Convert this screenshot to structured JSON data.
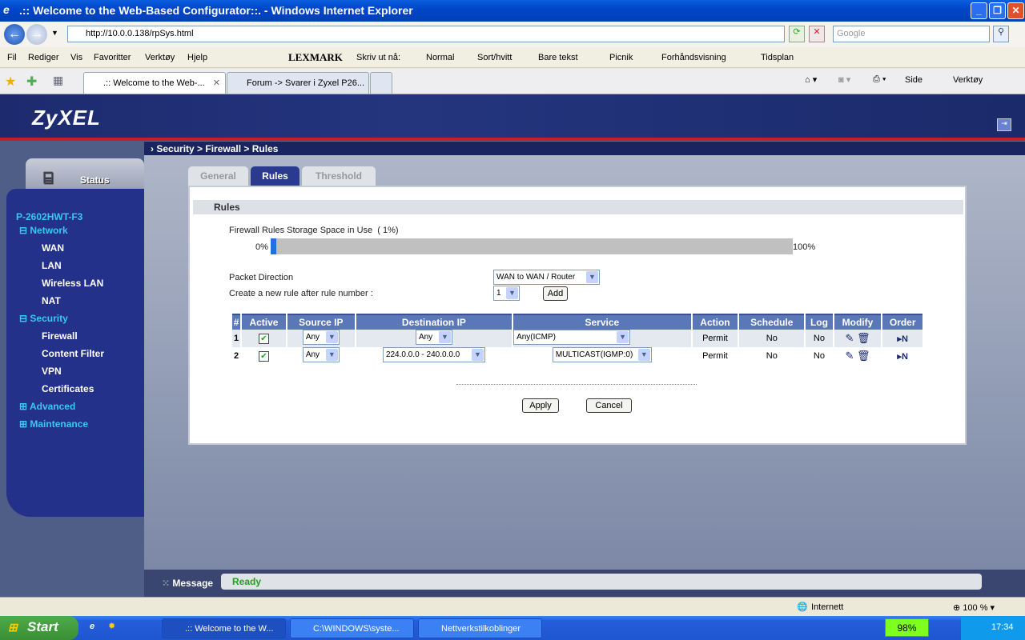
{
  "window": {
    "title": ".:: Welcome to the Web-Based Configurator::. - Windows Internet Explorer"
  },
  "address": {
    "url": "http://10.0.0.138/rpSys.html",
    "search_placeholder": "Google"
  },
  "menu": [
    "Fil",
    "Rediger",
    "Vis",
    "Favoritter",
    "Verktøy",
    "Hjelp"
  ],
  "lexmark": {
    "brand": "LEXMARK",
    "print_label": "Skriv ut nå:",
    "items": [
      "Normal",
      "Sort/hvitt",
      "Bare tekst",
      "Picnik",
      "Forhåndsvisning",
      "Tidsplan"
    ]
  },
  "tabs": [
    ".:: Welcome to the Web-...",
    "Forum -> Svarer i Zyxel P26..."
  ],
  "commandbar": {
    "page": "Side",
    "tools": "Verktøy"
  },
  "router": {
    "logo": "ZyXEL",
    "breadcrumb": "Security > Firewall > Rules",
    "status_tab": "Status",
    "model": "P-2602HWT-F3",
    "sidebar": [
      {
        "label": "Network",
        "sub": [
          "WAN",
          "LAN",
          "Wireless LAN",
          "NAT"
        ]
      },
      {
        "label": "Security",
        "sub": [
          "Firewall",
          "Content Filter",
          "VPN",
          "Certificates"
        ]
      },
      {
        "label": "Advanced",
        "sub": []
      },
      {
        "label": "Maintenance",
        "sub": []
      }
    ],
    "page_tabs": [
      "General",
      "Rules",
      "Threshold"
    ],
    "active_tab": "Rules",
    "section_title": "Rules",
    "storage": {
      "label": "Firewall Rules Storage Space in Use",
      "value_text": "( 1%)",
      "percent": 1,
      "min_label": "0%",
      "max_label": "100%"
    },
    "packet_direction": {
      "label": "Packet Direction",
      "value": "WAN to WAN / Router"
    },
    "new_rule": {
      "label": "Create a new rule after rule number :",
      "value": "1",
      "add_label": "Add"
    },
    "table": {
      "headers": [
        "#",
        "Active",
        "Source IP",
        "Destination IP",
        "Service",
        "Action",
        "Schedule",
        "Log",
        "Modify",
        "Order"
      ],
      "rows": [
        {
          "num": "1",
          "active": true,
          "source": "Any",
          "destination": "Any",
          "service": "Any(ICMP)",
          "action": "Permit",
          "schedule": "No",
          "log": "No"
        },
        {
          "num": "2",
          "active": true,
          "source": "Any",
          "destination": "224.0.0.0 - 240.0.0.0",
          "service": "MULTICAST(IGMP:0)",
          "action": "Permit",
          "schedule": "No",
          "log": "No"
        }
      ]
    },
    "apply_label": "Apply",
    "cancel_label": "Cancel",
    "message_label": "Message",
    "message_value": "Ready"
  },
  "statusbar": {
    "zone": "Internett",
    "zoom": "100 %"
  },
  "taskbar": {
    "start": "Start",
    "items": [
      ".:: Welcome to the W...",
      "C:\\WINDOWS\\syste...",
      "Nettverkstilkoblinger"
    ],
    "battery": "98%",
    "clock": "17:34"
  }
}
